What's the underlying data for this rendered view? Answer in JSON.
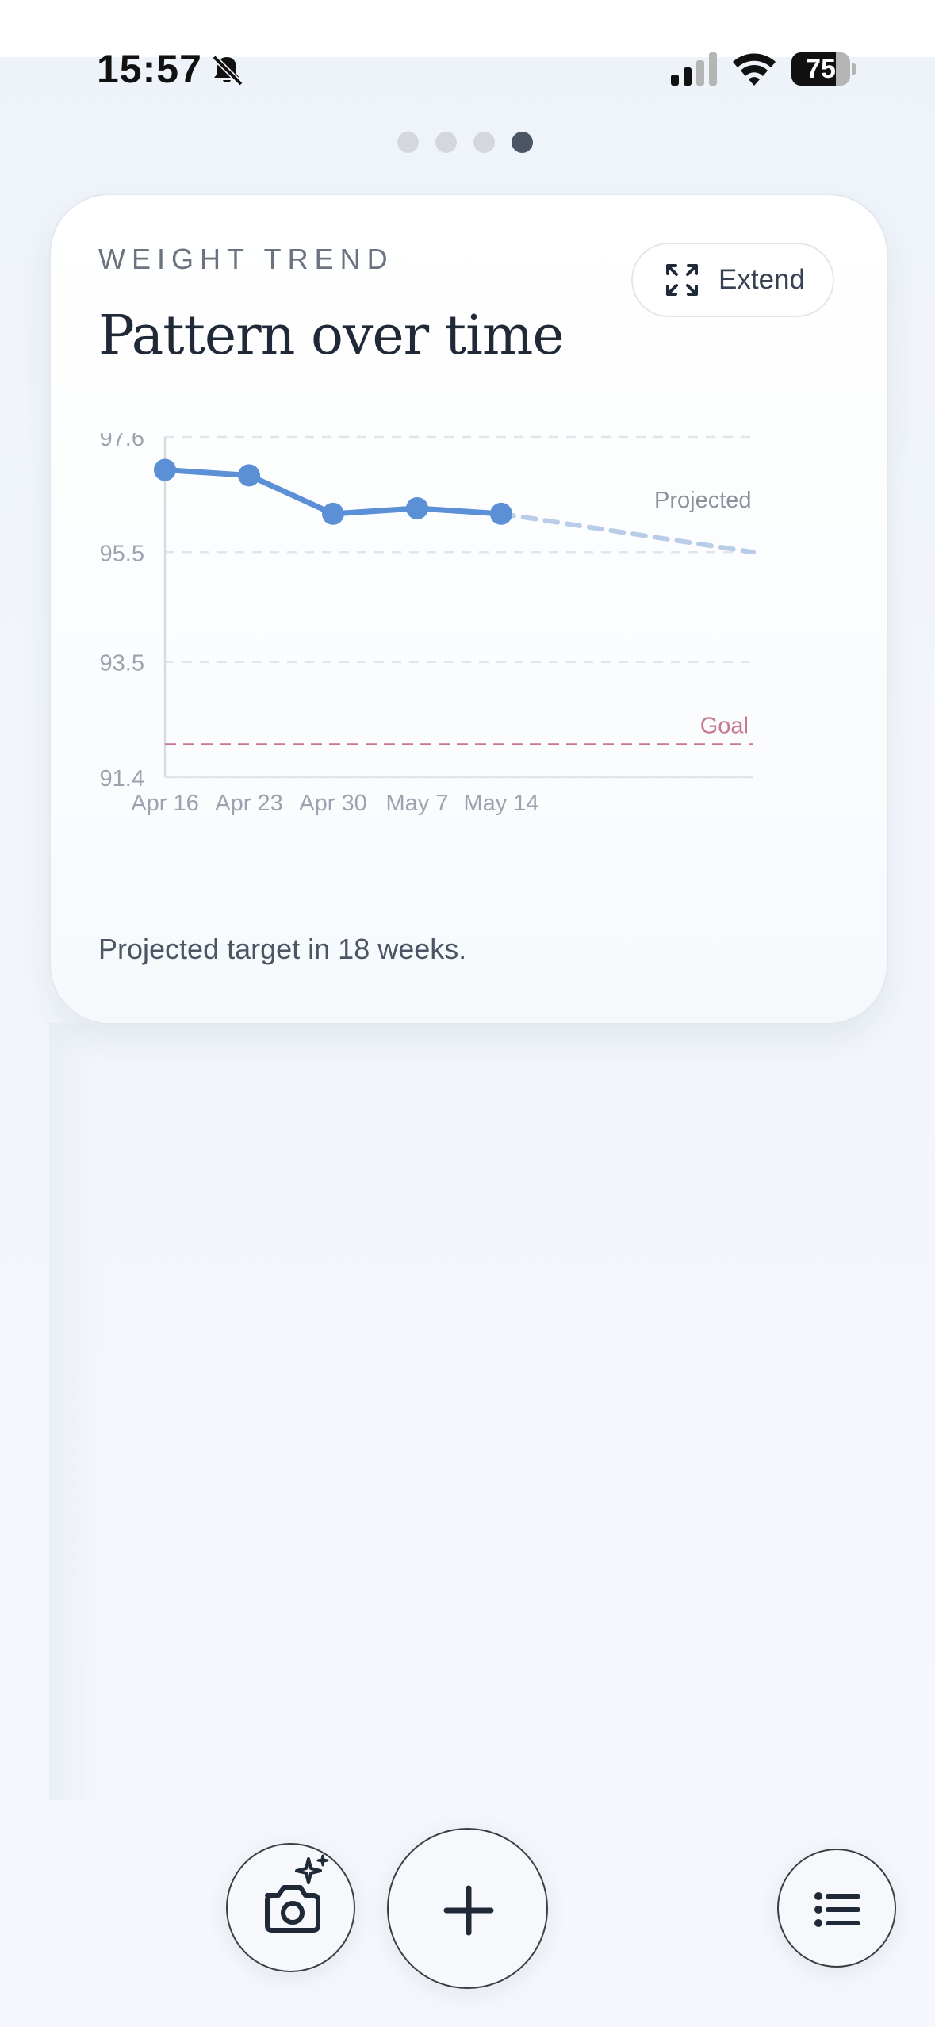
{
  "status_bar": {
    "time": "15:57",
    "battery": "75",
    "battery_percent": 75
  },
  "pager": {
    "count": 4,
    "active_index": 3
  },
  "card": {
    "eyebrow": "WEIGHT TREND",
    "title": "Pattern over time",
    "extend_label": "Extend",
    "summary": "Projected target in 18 weeks."
  },
  "chart_data": {
    "type": "line",
    "title": "",
    "xlabel": "",
    "ylabel": "",
    "x": [
      "Apr 16",
      "Apr 23",
      "Apr 30",
      "May 7",
      "May 14"
    ],
    "series": [
      {
        "values": [
          97.0,
          96.9,
          96.2,
          96.3,
          96.2
        ]
      }
    ],
    "projection": {
      "label": "Projected",
      "from": 96.2,
      "to": 95.5
    },
    "goal": {
      "label": "Goal",
      "value": 92.0
    },
    "yticks": [
      97.6,
      95.5,
      93.5,
      91.4
    ],
    "ylim": [
      91.4,
      97.6
    ],
    "grid": true,
    "colors": {
      "line": "#5b8fd6",
      "projection": "#b9cde8",
      "goal": "#c9778a"
    }
  }
}
